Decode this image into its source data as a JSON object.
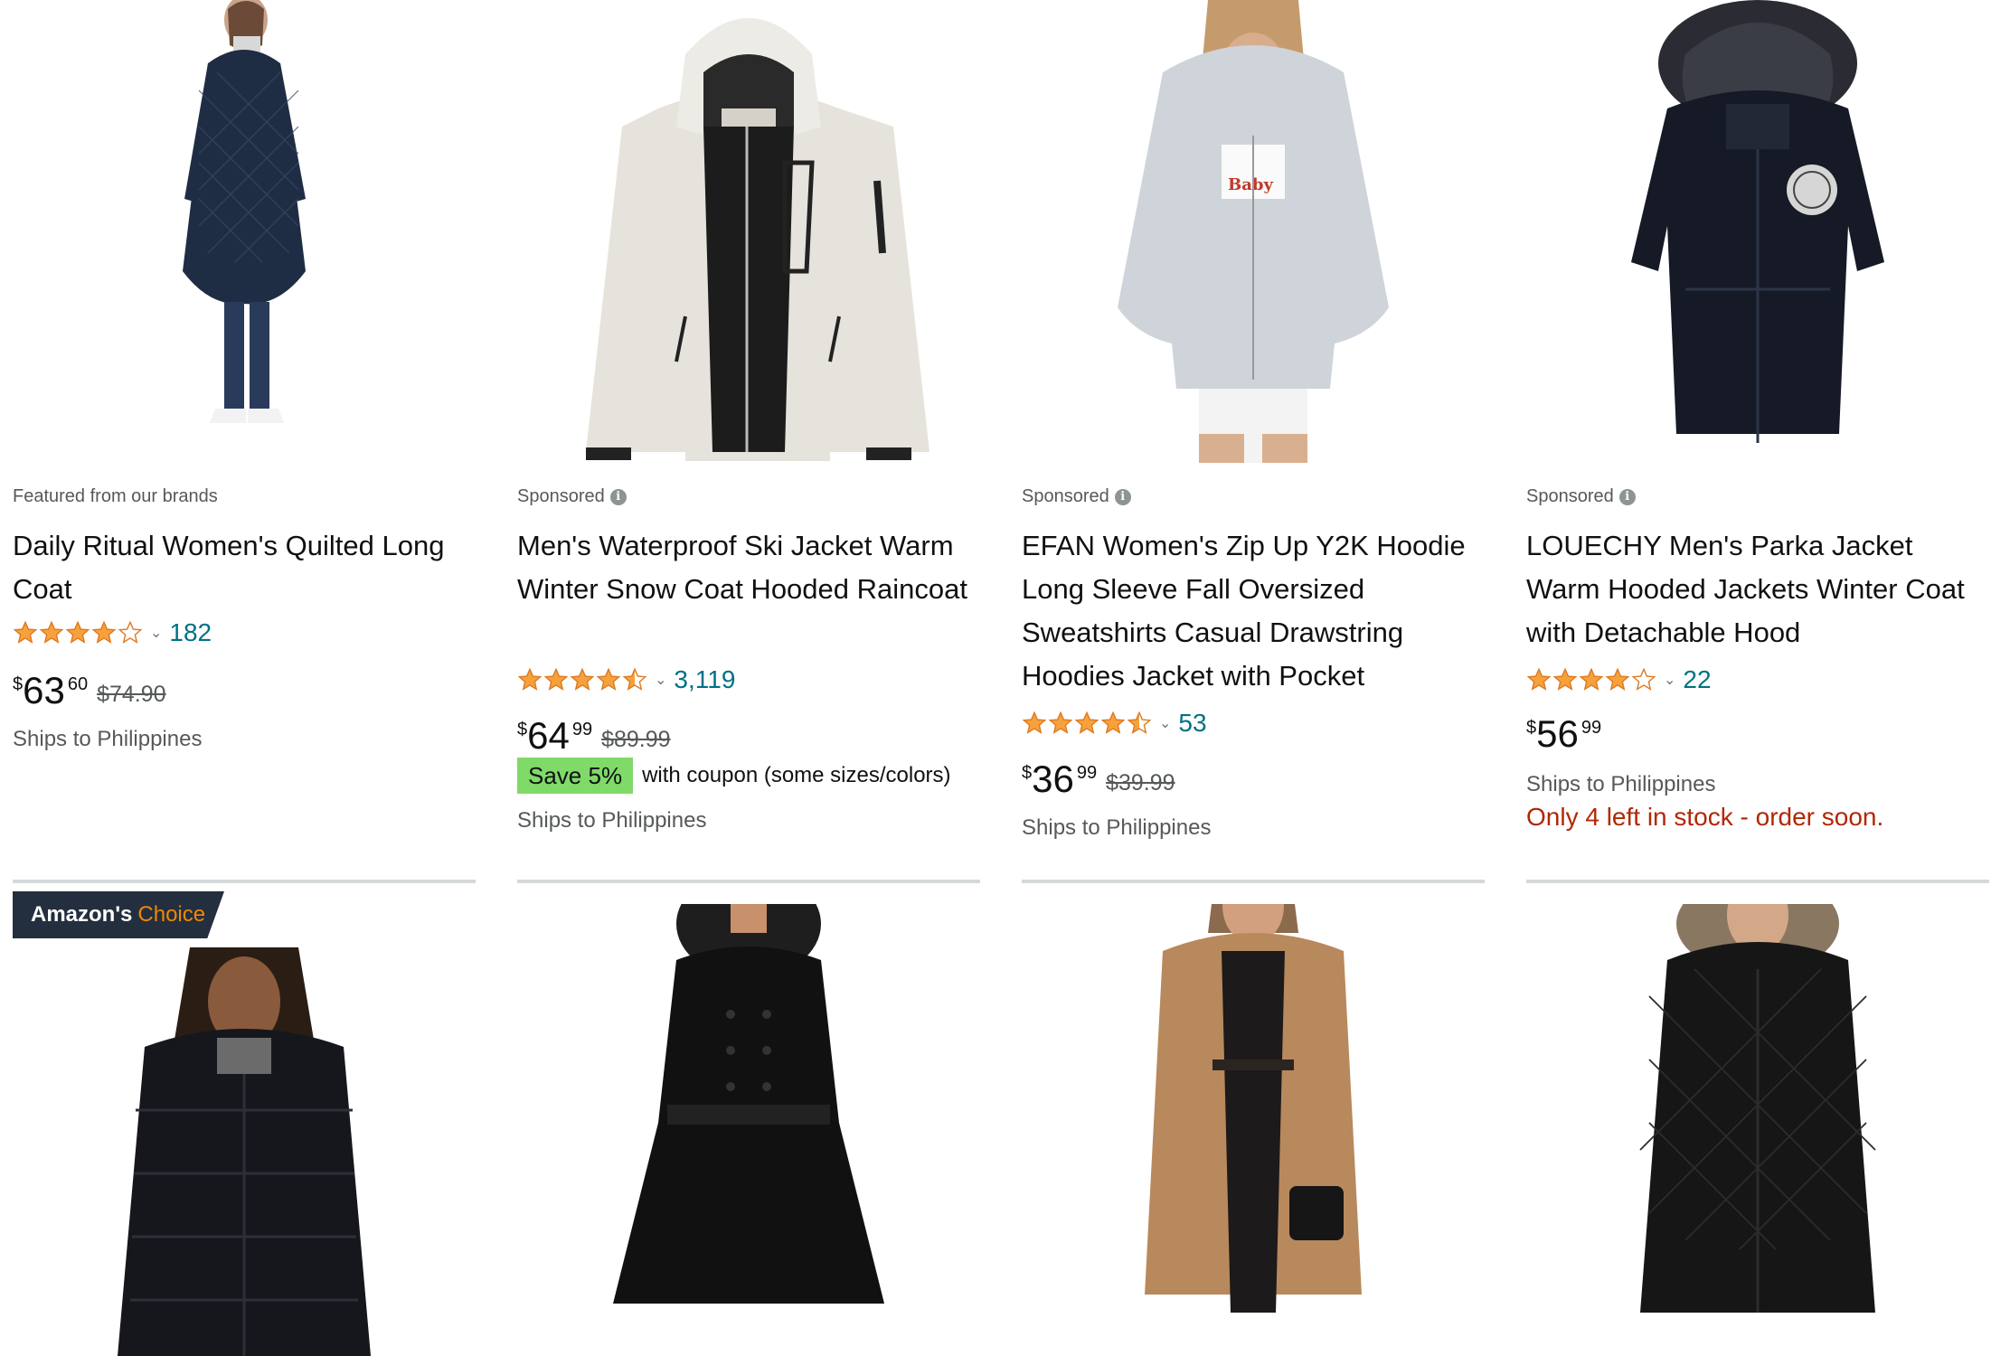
{
  "products": [
    {
      "image": "quilted-navy-long-coat",
      "meta": "Featured from our brands",
      "sponsored": false,
      "title": "Daily Ritual Women's Quilted Long Coat",
      "rating": 4.0,
      "rating_count": "182",
      "price_symbol": "$",
      "price_whole": "63",
      "price_fraction": "60",
      "list_price": "$74.90",
      "coupon": null,
      "ships": "Ships to Philippines",
      "stock": null
    },
    {
      "image": "white-ski-jacket",
      "meta": "Sponsored",
      "sponsored": true,
      "title": "Men's Waterproof Ski Jacket Warm Winter Snow Coat Hooded Raincoat",
      "rating": 4.5,
      "rating_count": "3,119",
      "price_symbol": "$",
      "price_whole": "64",
      "price_fraction": "99",
      "list_price": "$89.99",
      "coupon": {
        "badge": "Save 5%",
        "text": "with coupon (some sizes/colors)"
      },
      "ships": "Ships to Philippines",
      "stock": null
    },
    {
      "image": "grey-zip-hoodie",
      "meta": "Sponsored",
      "sponsored": true,
      "title": "EFAN Women's Zip Up Y2K Hoodie Long Sleeve Fall Oversized Sweatshirts Casual Drawstring Hoodies Jacket with Pocket",
      "rating": 4.5,
      "rating_count": "53",
      "price_symbol": "$",
      "price_whole": "36",
      "price_fraction": "99",
      "list_price": "$39.99",
      "coupon": null,
      "ships": "Ships to Philippines",
      "stock": null
    },
    {
      "image": "black-parka-fur-hood",
      "meta": "Sponsored",
      "sponsored": true,
      "title": "LOUECHY Men's Parka Jacket Warm Hooded Jackets Winter Coat with Detachable Hood",
      "rating": 4.0,
      "rating_count": "22",
      "price_symbol": "$",
      "price_whole": "56",
      "price_fraction": "99",
      "list_price": null,
      "coupon": null,
      "ships": "Ships to Philippines",
      "stock": "Only 4 left in stock - order soon."
    }
  ],
  "row2": [
    {
      "image": "black-puffer-jacket",
      "badge": {
        "prefix": "Amazon's",
        "accent": "Choice"
      }
    },
    {
      "image": "black-belted-swing-coat",
      "badge": null
    },
    {
      "image": "teddy-fleece-coat",
      "badge": null
    },
    {
      "image": "black-quilted-down-coat",
      "badge": null
    }
  ],
  "colors": {
    "star": "#f7a13c",
    "link": "#007185",
    "stock_red": "#b12704",
    "coupon_green": "#7fda69",
    "badge_navy": "#232f3e",
    "badge_orange": "#f08804"
  }
}
